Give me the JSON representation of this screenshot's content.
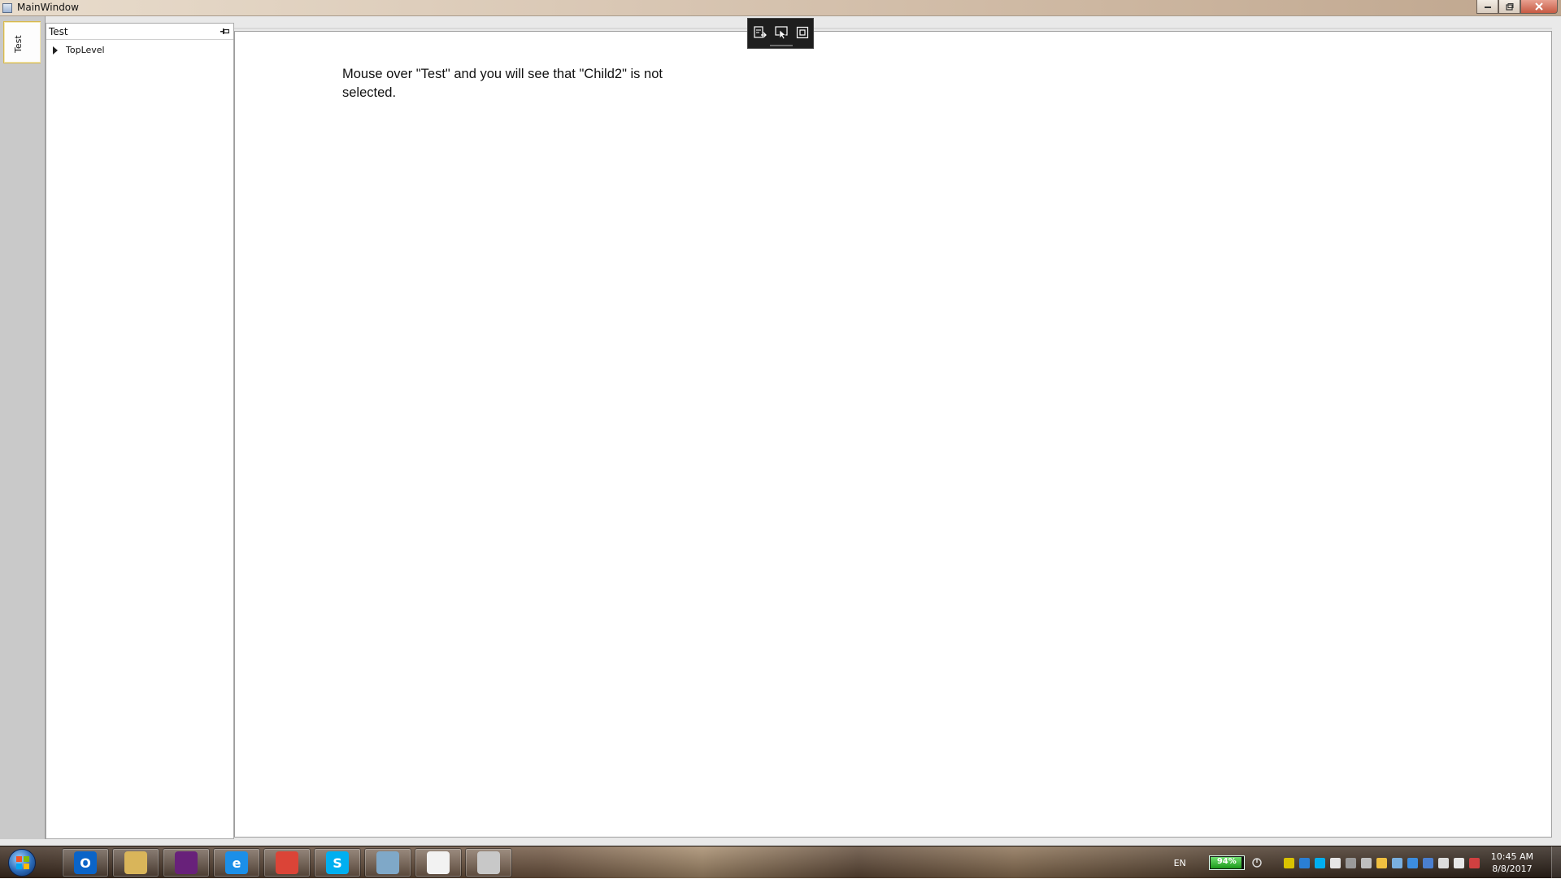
{
  "window": {
    "title": "MainWindow"
  },
  "side_tabs": [
    {
      "label": "Test"
    }
  ],
  "pane": {
    "title": "Test",
    "tree": [
      {
        "label": "TopLevel",
        "expanded": false
      }
    ]
  },
  "content": {
    "message": "Mouse over \"Test\" and you will see that \"Child2\" is not selected."
  },
  "debug_toolbar": {
    "buttons": [
      "live-visual-tree-icon",
      "select-element-icon",
      "layout-adorners-icon"
    ]
  },
  "taskbar": {
    "pinned": [
      {
        "name": "outlook",
        "glyph": "O",
        "color": "#0a64c8"
      },
      {
        "name": "explorer",
        "glyph": "",
        "color": "#d9b55a"
      },
      {
        "name": "visual-studio",
        "glyph": "",
        "color": "#68217a"
      },
      {
        "name": "internet-explorer",
        "glyph": "e",
        "color": "#1b8fe8"
      },
      {
        "name": "chrome",
        "glyph": "",
        "color": "#db4437"
      },
      {
        "name": "skype",
        "glyph": "S",
        "color": "#00aff0"
      },
      {
        "name": "notes",
        "glyph": "",
        "color": "#7fa8c8"
      },
      {
        "name": "calendar-app",
        "glyph": "",
        "color": "#f2f2f2"
      },
      {
        "name": "paint",
        "glyph": "",
        "color": "#c8c8c8"
      }
    ],
    "language": "EN",
    "battery_percent": "94%",
    "battery_level": 0.94,
    "time": "10:45 AM",
    "date": "8/8/2017"
  }
}
